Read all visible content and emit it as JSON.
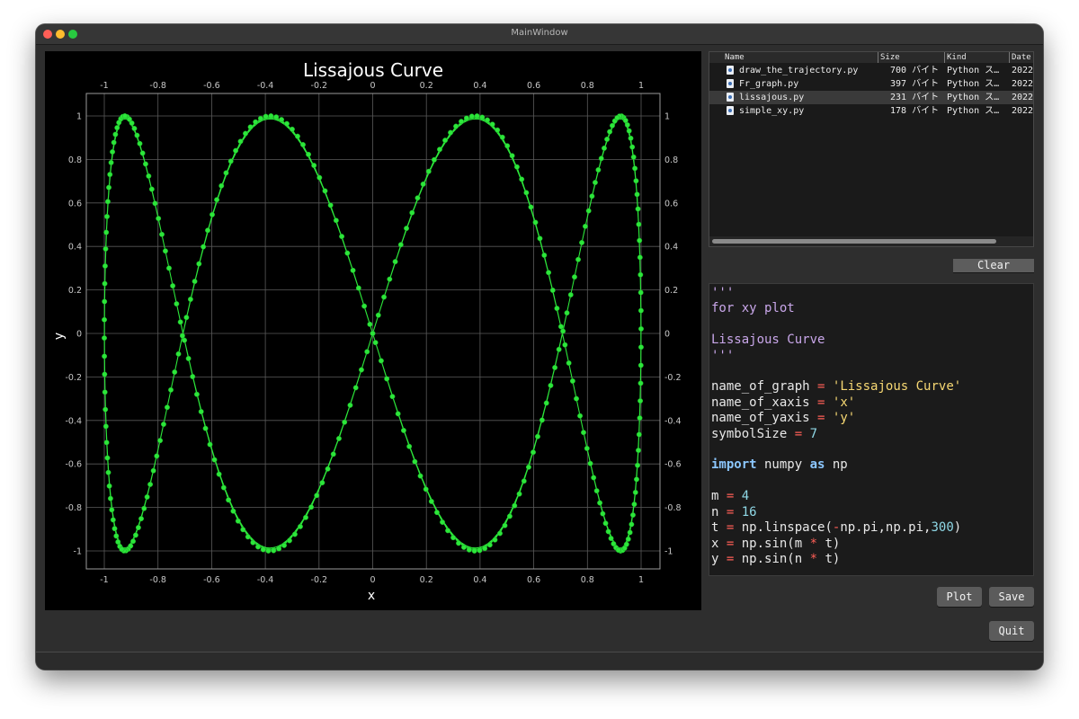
{
  "window": {
    "title": "MainWindow"
  },
  "chart_data": {
    "type": "scatter",
    "mode": "lines+markers",
    "title": "Lissajous Curve",
    "xlabel": "x",
    "ylabel": "y",
    "xlim": [
      -1.0,
      1.0
    ],
    "ylim": [
      -1.0,
      1.0
    ],
    "xticks": [
      "-1",
      "-0.8",
      "-0.6",
      "-0.4",
      "-0.2",
      "0",
      "0.2",
      "0.4",
      "0.6",
      "0.8",
      "1"
    ],
    "yticks": [
      "-1",
      "-0.8",
      "-0.6",
      "-0.4",
      "-0.2",
      "0",
      "0.2",
      "0.4",
      "0.6",
      "0.8",
      "1"
    ],
    "grid": true,
    "series": [
      {
        "m": 4,
        "n": 16,
        "t_range": [
          -3.14159,
          3.14159
        ],
        "num_points": 300,
        "marker_size": 7,
        "color": "#2ce63a"
      }
    ]
  },
  "filelist": {
    "headers": {
      "name": "Name",
      "size": "Size",
      "kind": "Kind",
      "date": "Date"
    },
    "rows": [
      {
        "name": "draw_the_trajectory.py",
        "size": "700 バイト",
        "kind": "Python ス…",
        "date": "2022",
        "selected": false
      },
      {
        "name": "Fr_graph.py",
        "size": "397 バイト",
        "kind": "Python ス…",
        "date": "2022",
        "selected": false
      },
      {
        "name": "lissajous.py",
        "size": "231 バイト",
        "kind": "Python ス…",
        "date": "2022",
        "selected": true
      },
      {
        "name": "simple_xy.py",
        "size": "178 バイト",
        "kind": "Python ス…",
        "date": "2022",
        "selected": false
      }
    ]
  },
  "buttons": {
    "clear": "Clear",
    "plot": "Plot",
    "save": "Save",
    "quit": "Quit"
  },
  "editor": {
    "lines": [
      [
        [
          "doc",
          "'''"
        ]
      ],
      [
        [
          "doc",
          "for xy plot"
        ]
      ],
      [],
      [
        [
          "doc",
          "Lissajous Curve"
        ]
      ],
      [
        [
          "doc",
          "'''"
        ]
      ],
      [],
      [
        [
          "plain",
          "name_of_graph "
        ],
        [
          "op",
          "="
        ],
        [
          "plain",
          " "
        ],
        [
          "str",
          "'Lissajous Curve'"
        ]
      ],
      [
        [
          "plain",
          "name_of_xaxis "
        ],
        [
          "op",
          "="
        ],
        [
          "plain",
          " "
        ],
        [
          "str",
          "'x'"
        ]
      ],
      [
        [
          "plain",
          "name_of_yaxis "
        ],
        [
          "op",
          "="
        ],
        [
          "plain",
          " "
        ],
        [
          "str",
          "'y'"
        ]
      ],
      [
        [
          "plain",
          "symbolSize "
        ],
        [
          "op",
          "="
        ],
        [
          "plain",
          " "
        ],
        [
          "num",
          "7"
        ]
      ],
      [],
      [
        [
          "kw",
          "import"
        ],
        [
          "plain",
          " numpy "
        ],
        [
          "kw",
          "as"
        ],
        [
          "plain",
          " np"
        ]
      ],
      [],
      [
        [
          "plain",
          "m "
        ],
        [
          "op",
          "="
        ],
        [
          "plain",
          " "
        ],
        [
          "num",
          "4"
        ]
      ],
      [
        [
          "plain",
          "n "
        ],
        [
          "op",
          "="
        ],
        [
          "plain",
          " "
        ],
        [
          "num",
          "16"
        ]
      ],
      [
        [
          "plain",
          "t "
        ],
        [
          "op",
          "="
        ],
        [
          "plain",
          " np.linspace("
        ],
        [
          "op",
          "-"
        ],
        [
          "plain",
          "np.pi,np.pi,"
        ],
        [
          "num",
          "300"
        ],
        [
          "plain",
          ")"
        ]
      ],
      [
        [
          "plain",
          "x "
        ],
        [
          "op",
          "="
        ],
        [
          "plain",
          " np.sin(m "
        ],
        [
          "op",
          "*"
        ],
        [
          "plain",
          " t)"
        ]
      ],
      [
        [
          "plain",
          "y "
        ],
        [
          "op",
          "="
        ],
        [
          "plain",
          " np.sin(n "
        ],
        [
          "op",
          "*"
        ],
        [
          "plain",
          " t)"
        ]
      ]
    ]
  }
}
